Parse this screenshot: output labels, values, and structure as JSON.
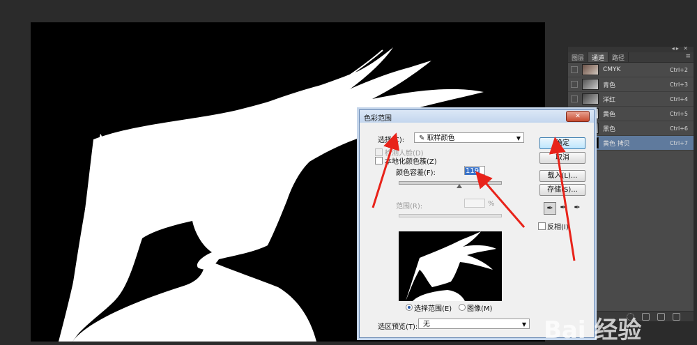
{
  "channels_panel": {
    "tabs": [
      "图层",
      "通道",
      "路径"
    ],
    "channels": [
      {
        "name": "CMYK",
        "shortcut": "Ctrl+2"
      },
      {
        "name": "青色",
        "shortcut": "Ctrl+3"
      },
      {
        "name": "洋红",
        "shortcut": "Ctrl+4"
      },
      {
        "name": "黄色",
        "shortcut": "Ctrl+5"
      },
      {
        "name": "黑色",
        "shortcut": "Ctrl+6"
      },
      {
        "name": "黄色 拷贝",
        "shortcut": "Ctrl+7"
      }
    ]
  },
  "dialog": {
    "title": "色彩范围",
    "select_label": "选择(C):",
    "select_value": "取样颜色",
    "detect_faces": "检测人脸(D)",
    "localized": "本地化颜色簇(Z)",
    "fuzziness_label": "颜色容差(F):",
    "fuzziness_value": "119",
    "range_label": "范围(R):",
    "range_unit": "%",
    "radio_selection": "选择范围(E)",
    "radio_image": "图像(M)",
    "preview_label": "选区预览(T):",
    "preview_value": "无",
    "ok": "确定",
    "cancel": "取消",
    "load": "载入(L)...",
    "save": "存储(S)...",
    "invert": "反相(I)"
  },
  "watermark": "Bai 经验",
  "colors": {
    "accent": "#3a73c9",
    "arrow": "#e8231a",
    "selected_row": "#5f7a9d"
  }
}
